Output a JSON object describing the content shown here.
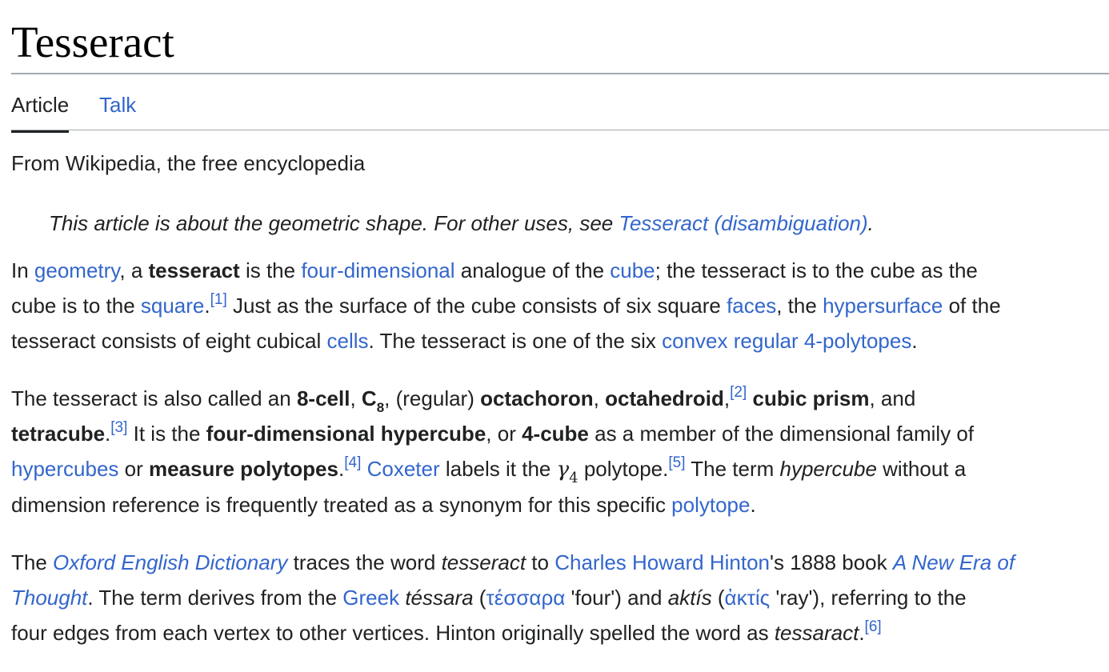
{
  "page": {
    "title": "Tesseract"
  },
  "tabs": {
    "article": "Article",
    "talk": "Talk"
  },
  "tagline": "From Wikipedia, the free encyclopedia",
  "hatnote": {
    "text": "This article is about the geometric shape. For other uses, see ",
    "link": "Tesseract (disambiguation)",
    "end": "."
  },
  "p1": {
    "l1": {
      "a": "In ",
      "geometry": "geometry",
      "b": ", a ",
      "tesseract": "tesseract",
      "c": " is the ",
      "fourdim": "four-dimensional",
      "d": " analogue of the ",
      "cube": "cube",
      "e": "; the tesseract is to the cube as the"
    },
    "l2": {
      "a": "cube is to the ",
      "square": "square",
      "b": ".",
      "ref1": "[1]",
      "c": " Just as the surface of the cube consists of six square ",
      "faces": "faces",
      "d": ", the ",
      "hypersurface": "hypersurface",
      "e": " of the"
    },
    "l3": {
      "a": "tesseract consists of eight cubical ",
      "cells": "cells",
      "b": ". The tesseract is one of the six ",
      "convex": "convex regular 4-polytopes",
      "c": "."
    }
  },
  "p2": {
    "l1": {
      "a": "The tesseract is also called an ",
      "cell8": "8-cell",
      "b": ", ",
      "c8": "C",
      "c8sub": "8",
      "c": ", (regular) ",
      "octachoron": "octachoron",
      "d": ", ",
      "octahedroid": "octahedroid",
      "e": ",",
      "ref2": "[2]",
      "f": " ",
      "cubicprism": "cubic prism",
      "g": ", and"
    },
    "l2": {
      "tetracube": "tetracube",
      "a": ".",
      "ref3": "[3]",
      "b": " It is the ",
      "hypercube": "four-dimensional hypercube",
      "c": ", or ",
      "cube4": "4-cube",
      "d": " as a member of the dimensional family of"
    },
    "l3": {
      "hypercubes": "hypercubes",
      "a": " or ",
      "measure": "measure polytopes",
      "b": ".",
      "ref4": "[4]",
      "c": " ",
      "coxeter": "Coxeter",
      "d": " labels it the ",
      "gamma": "γ",
      "gammasub": "4",
      "e": " polytope.",
      "ref5": "[5]",
      "f": " The term ",
      "hypercube_it": "hypercube",
      "g": " without a"
    },
    "l4": {
      "a": "dimension reference is frequently treated as a synonym for this specific ",
      "polytope": "polytope",
      "b": "."
    }
  },
  "p3": {
    "l1": {
      "a": "The ",
      "oed": "Oxford English Dictionary",
      "b": " traces the word ",
      "tesseract_it": "tesseract",
      "c": " to ",
      "hinton": "Charles Howard Hinton",
      "d": "'s 1888 book ",
      "book1": "A New Era of"
    },
    "l2": {
      "book2": "Thought",
      "a": ". The term derives from the ",
      "greek": "Greek",
      "b": " ",
      "tessara": "téssara",
      "c": " (",
      "tessara_gr": "τέσσαρα",
      "d": " 'four') and ",
      "aktis": "aktís",
      "e": " (",
      "aktis_gr": "ἀκτίς",
      "f": " 'ray'), referring to the"
    },
    "l3": {
      "a": "four edges from each vertex to other vertices. Hinton originally spelled the word as ",
      "tessaract": "tessaract",
      "b": ".",
      "ref6": "[6]"
    }
  }
}
